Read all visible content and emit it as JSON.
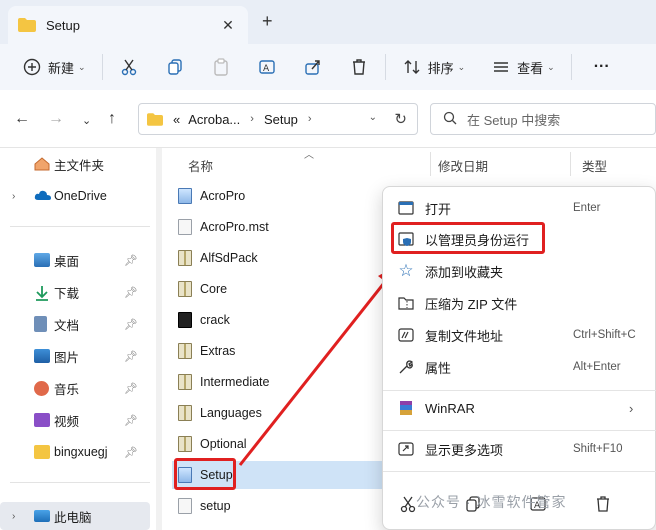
{
  "window": {
    "tab_title": "Setup",
    "close_glyph": "✕",
    "newtab_glyph": "+"
  },
  "toolbar": {
    "new_label": "新建",
    "sort_label": "排序",
    "view_label": "查看",
    "more_label": "···"
  },
  "address": {
    "prefix": "«",
    "crumbs": [
      "Acroba...",
      "Setup"
    ],
    "search_placeholder": "在 Setup 中搜索"
  },
  "sidebar": {
    "items": [
      {
        "label": "主文件夹",
        "icon": "home-icon"
      },
      {
        "label": "OneDrive",
        "icon": "cloud-icon"
      },
      {
        "label": "桌面",
        "icon": "desktop-icon"
      },
      {
        "label": "下载",
        "icon": "download-icon"
      },
      {
        "label": "文档",
        "icon": "document-icon"
      },
      {
        "label": "图片",
        "icon": "picture-icon"
      },
      {
        "label": "音乐",
        "icon": "music-icon"
      },
      {
        "label": "视频",
        "icon": "video-icon"
      },
      {
        "label": "bingxuegj",
        "icon": "folder-icon"
      },
      {
        "label": "此电脑",
        "icon": "computer-icon"
      }
    ]
  },
  "columns": {
    "name": "名称",
    "modified": "修改日期",
    "type": "类型"
  },
  "files": [
    {
      "name": "AcroPro",
      "kind": "exe"
    },
    {
      "name": "AcroPro.mst",
      "kind": "file"
    },
    {
      "name": "AlfSdPack",
      "kind": "zip"
    },
    {
      "name": "Core",
      "kind": "zip"
    },
    {
      "name": "crack",
      "kind": "pdf"
    },
    {
      "name": "Extras",
      "kind": "zip"
    },
    {
      "name": "Intermediate",
      "kind": "zip"
    },
    {
      "name": "Languages",
      "kind": "zip"
    },
    {
      "name": "Optional",
      "kind": "zip"
    },
    {
      "name": "Setup",
      "kind": "exe"
    },
    {
      "name": "setup",
      "kind": "file"
    }
  ],
  "context_menu": {
    "items": [
      {
        "label": "打开",
        "shortcut": "Enter"
      },
      {
        "label": "以管理员身份运行",
        "shortcut": ""
      },
      {
        "label": "添加到收藏夹",
        "shortcut": ""
      },
      {
        "label": "压缩为 ZIP 文件",
        "shortcut": ""
      },
      {
        "label": "复制文件地址",
        "shortcut": "Ctrl+Shift+C"
      },
      {
        "label": "属性",
        "shortcut": "Alt+Enter"
      },
      {
        "label": "WinRAR",
        "shortcut": ""
      },
      {
        "label": "显示更多选项",
        "shortcut": "Shift+F10"
      }
    ]
  },
  "watermark": "公众号 · 冰雪软件管家",
  "colors": {
    "highlight": "#e02020",
    "selection": "#cfe3f7",
    "chrome": "#f3f6fb"
  }
}
